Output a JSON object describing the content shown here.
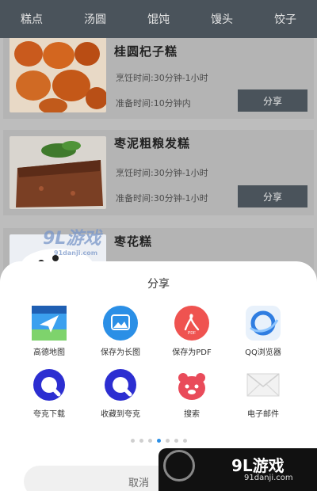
{
  "topbar": {
    "tabs": [
      "糕点",
      "汤圆",
      "馄饨",
      "馒头",
      "饺子"
    ]
  },
  "recipes": [
    {
      "title": "桂圆杞子糕",
      "cook_time": "烹饪时间:30分钟-1小时",
      "prep_time": "准备时间:10分钟内",
      "share_label": "分享"
    },
    {
      "title": "枣泥粗粮发糕",
      "cook_time": "烹饪时间:30分钟-1小时",
      "prep_time": "准备时间:30分钟-1小时",
      "share_label": "分享"
    },
    {
      "title": "枣花糕"
    }
  ],
  "share_sheet": {
    "title": "分享",
    "options": [
      {
        "label": "高德地图",
        "icon": "amap-icon"
      },
      {
        "label": "保存为长图",
        "icon": "save-long-image-icon"
      },
      {
        "label": "保存为PDF",
        "icon": "pdf-icon"
      },
      {
        "label": "QQ浏览器",
        "icon": "qq-browser-icon"
      },
      {
        "label": "夸克下载",
        "icon": "quark-download-icon"
      },
      {
        "label": "收藏到夸克",
        "icon": "quark-favorite-icon"
      },
      {
        "label": "搜索",
        "icon": "search-icon"
      },
      {
        "label": "电子邮件",
        "icon": "email-icon"
      }
    ],
    "page_count": 7,
    "active_page": 4,
    "cancel_label": "取消"
  },
  "watermark": {
    "logo": "9L游戏",
    "url": "91danji.com",
    "small_logo": "9L游戏",
    "small_url": "91danji.com"
  },
  "colors": {
    "topbar": "#4a535b",
    "button": "#4a535b",
    "sheet": "#ffffff",
    "dot_active": "#2b8fe6"
  }
}
